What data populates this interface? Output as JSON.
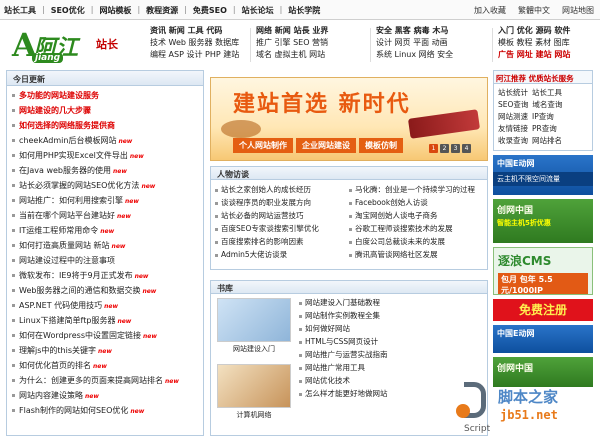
{
  "topbar": {
    "links": [
      "站长工具",
      "SEO优化",
      "网站模板",
      "教程资源",
      "免费SEO",
      "站长论坛",
      "站长学院"
    ],
    "right": [
      "加入收藏",
      "繁體中文",
      "网站地图"
    ]
  },
  "header": {
    "logo_main": "阿江",
    "logo_letter": "A",
    "logo_sub": "jiang",
    "badge": "站长",
    "nav_cols": [
      [
        "资讯 新闻 工具 代码",
        "技术 Web 服务器 数据库",
        "编程 ASP 设计 PHP 建站"
      ],
      [
        "网络 新闻 站長 业界",
        "推广 引擎 SEO 营销",
        "域名 虚拟主机 网站"
      ],
      [
        "安全 黑客 病毒 木马",
        "设计 网页 平面 动画",
        "系统 Linux 网络 安全"
      ],
      [
        "入门 优化 源码 软件",
        "模板 教程 素材 图库",
        "广告 网址 建站 网站"
      ]
    ]
  },
  "sidebar": {
    "title": "今日更新",
    "items": [
      {
        "text": "多功能的网站建设服务",
        "hl": true,
        "new": false
      },
      {
        "text": "网站建设的几大步骤",
        "hl": true,
        "new": false
      },
      {
        "text": "如何选择的网络服务提供商",
        "hl": true,
        "new": false
      },
      {
        "text": "cheekAdmin后台模板网站",
        "hl": false,
        "new": true
      },
      {
        "text": "如何用PHP实现Excel文件导出",
        "hl": false,
        "new": true
      },
      {
        "text": "在Java web服务器的使用",
        "hl": false,
        "new": true
      },
      {
        "text": "站长必须掌握的网站SEO优化方法",
        "hl": false,
        "new": true
      },
      {
        "text": "网站推广：如何利用搜索引擎",
        "hl": false,
        "new": true
      },
      {
        "text": "当前在哪个网站平台建站好",
        "hl": false,
        "new": true
      },
      {
        "text": "IT运维工程师常用命令",
        "hl": false,
        "new": true
      },
      {
        "text": "如何打造高质量网站 新站",
        "hl": false,
        "new": true
      },
      {
        "text": "网站建设过程中的注意事项",
        "hl": false,
        "new": false
      },
      {
        "text": "微软发布：IE9将于9月正式发布",
        "hl": false,
        "new": true
      },
      {
        "text": "Web服务器之间的通信和数据交换",
        "hl": false,
        "new": true
      },
      {
        "text": "ASP.NET 代码使用技巧",
        "hl": false,
        "new": true
      },
      {
        "text": "Linux下搭建简单ftp服务器",
        "hl": false,
        "new": true
      },
      {
        "text": "如何在Wordpress中设置固定链接",
        "hl": false,
        "new": true
      },
      {
        "text": "理解js中的this关键字",
        "hl": false,
        "new": true
      },
      {
        "text": "如何优化首页的排名",
        "hl": false,
        "new": true
      },
      {
        "text": "为什么：创建更多的页面来提高网站排名",
        "hl": false,
        "new": true
      },
      {
        "text": "网站内容建设策略",
        "hl": false,
        "new": true
      },
      {
        "text": "Flash制作的网站如何SEO优化",
        "hl": false,
        "new": true
      }
    ]
  },
  "banner": {
    "title": "建站首选 新时代",
    "tabs": [
      "个人网站制作",
      "企业网站建设",
      "模板仿制"
    ],
    "pages": [
      "1",
      "2",
      "3",
      "4"
    ]
  },
  "people": {
    "title": "人物访谈",
    "left": [
      "站长之家创始人的成长经历",
      "谈谈程序员的职业发展方向",
      "站长必备的网站运营技巧",
      "百度SEO专家谈搜索引擎优化",
      "百度搜索排名的影响因素",
      "Admin5大佬访谈录"
    ],
    "right": [
      "马化腾：创业是一个持续学习的过程",
      "Facebook创始人访谈",
      "淘宝网创始人谈电子商务",
      "谷歌工程师谈搜索技术的发展",
      "白度公司总裁谈未来的发展",
      "腾讯高管谈网络社区发展"
    ]
  },
  "books": {
    "title": "书库",
    "covers": [
      "网站建设入门",
      "计算机网络"
    ],
    "items": [
      "网站建设入门基础教程",
      "网站制作实例教程全集",
      "如何做好网站",
      "HTML与CSS网页设计",
      "网站推广与运营实战指南",
      "网站推广常用工具",
      "网站优化技术",
      "怎么样才能更好地做网站"
    ]
  },
  "rightcol": {
    "hot": "阿江推荐 优质站长服务",
    "cloud": [
      "站长统计",
      "站长工具",
      "SEO查询",
      "域名查询",
      "网站测速",
      "IP查询",
      "友情链接",
      "PR查询",
      "收录查询",
      "网站排名"
    ],
    "ad1": {
      "t1": "中国E动网",
      "t2": "云主机不限空间流量"
    },
    "ad2": {
      "t1": "创网中国",
      "t2": "智能主机5折优惠"
    },
    "ad3": {
      "t1": "逐浪CMS",
      "t2": "包月 包年 5.5元/1000IP"
    },
    "reg": "免费注册"
  },
  "watermark": {
    "cn": "脚本之家",
    "url": "jb51.net",
    "script": "Script"
  }
}
